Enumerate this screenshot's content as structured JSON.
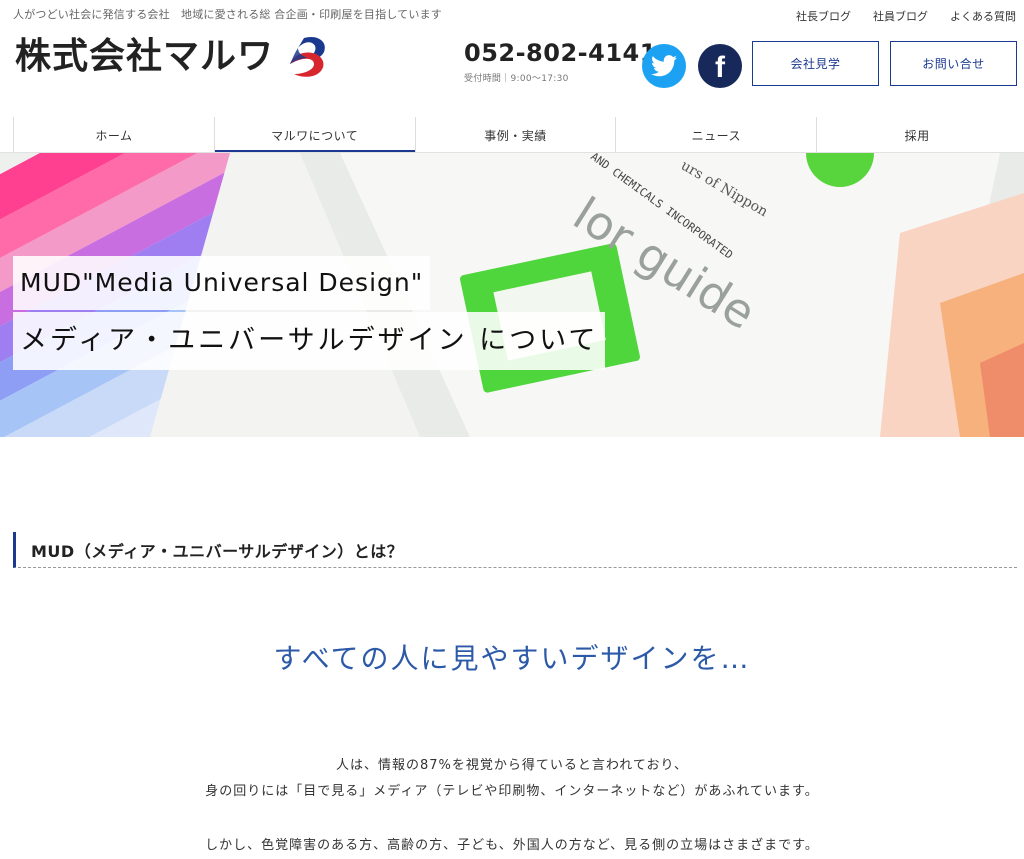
{
  "header": {
    "tagline": "人がつどい社会に発信する会社　地域に愛される総 合企画・印刷屋を目指しています",
    "top_links": [
      "社長ブログ",
      "社員ブログ",
      "よくある質問"
    ],
    "logo_text": "株式会社マルワ",
    "logo_mark": "maruwa-swoosh-logo",
    "phone": "052-802-4141",
    "hours": "受付時間｜9:00〜17:30",
    "sns": {
      "twitter": "twitter-icon",
      "facebook": "facebook-icon",
      "facebook_letter": "f"
    },
    "buttons": {
      "visit": "会社見学",
      "contact": "お問い合せ"
    }
  },
  "nav": {
    "items": [
      "ホーム",
      "マルワについて",
      "事例・実績",
      "ニュース",
      "採用"
    ],
    "active_index": 1
  },
  "hero": {
    "title_en": "MUD\"Media Universal Design\"",
    "title_ja": "メディア・ユニバーサルデザイン について"
  },
  "section": {
    "heading": "MUD（メディア・ユニバーサルデザイン）とは？",
    "lead": "すべての人に見やすいデザインを…",
    "paragraphs": [
      "人は、情報の87%を視覚から得ていると言われており、",
      "身の回りには「目で見る」メディア（テレビや印刷物、インターネットなど）があふれています。",
      "しかし、色覚障害のある方、高齢の方、子ども、外国人の方など、見る側の立場はさまざまです。"
    ]
  },
  "colors": {
    "brand_blue": "#1b3a8f",
    "twitter": "#1da1f2",
    "facebook": "#17295a",
    "lead_blue": "#2d5aa8"
  }
}
